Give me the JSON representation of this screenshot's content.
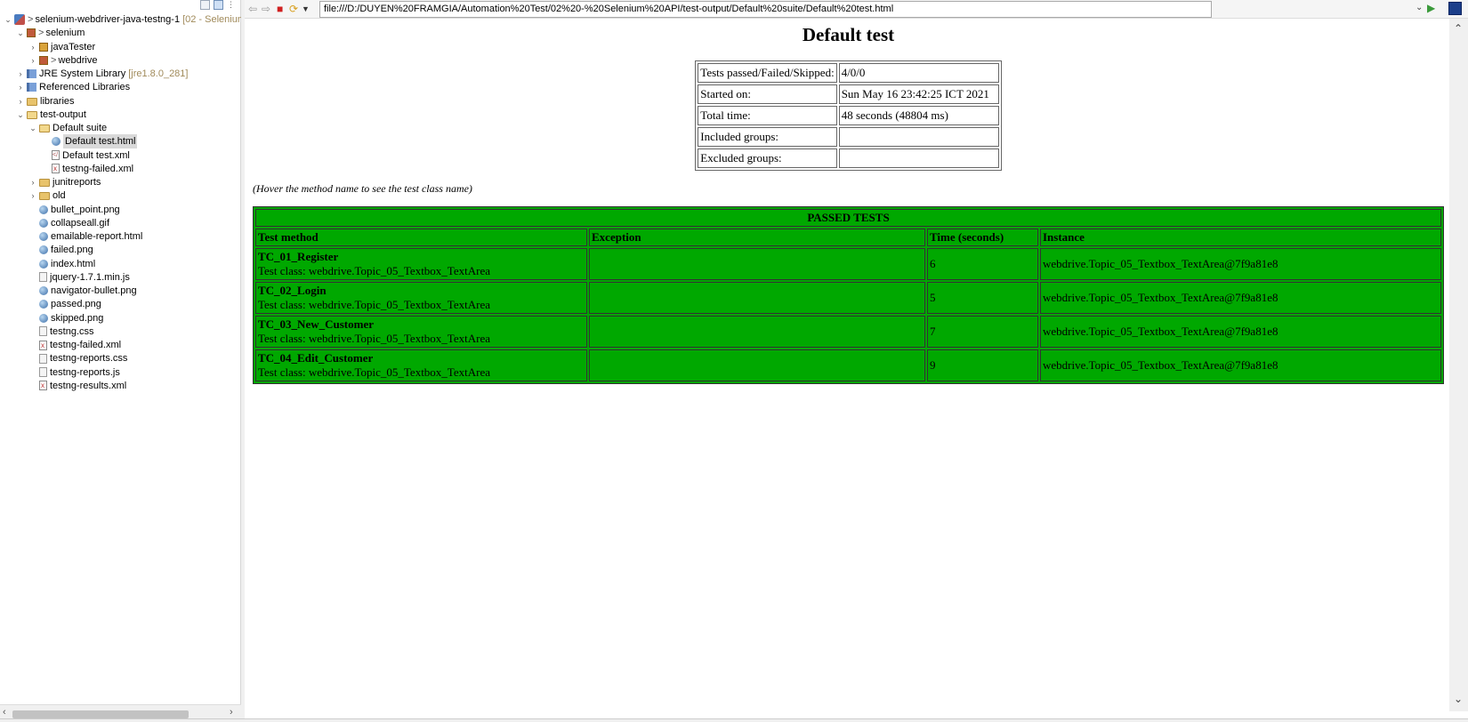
{
  "explorer": {
    "items": [
      {
        "label": "selenium-webdriver-java-testng-1",
        "extra": "[02 - Selenium",
        "prefix": ">",
        "chevron": "v",
        "icon": "project",
        "indent": 0
      },
      {
        "label": "selenium",
        "prefix": ">",
        "chevron": "v",
        "icon": "pkg-red",
        "indent": 1
      },
      {
        "label": "javaTester",
        "chevron": ">",
        "icon": "pkg",
        "indent": 2
      },
      {
        "label": "webdrive",
        "prefix": ">",
        "chevron": ">",
        "icon": "pkg-red",
        "indent": 2
      },
      {
        "label": "JRE System Library",
        "extra": "[jre1.8.0_281]",
        "chevron": ">",
        "icon": "lib",
        "indent": 1
      },
      {
        "label": "Referenced Libraries",
        "chevron": ">",
        "icon": "lib",
        "indent": 1
      },
      {
        "label": "libraries",
        "chevron": ">",
        "icon": "folder",
        "indent": 1
      },
      {
        "label": "test-output",
        "chevron": "v",
        "icon": "folder-open",
        "indent": 1
      },
      {
        "label": "Default suite",
        "chevron": "v",
        "icon": "folder-open",
        "indent": 2
      },
      {
        "label": "Default test.html",
        "icon": "globe",
        "indent": 3,
        "selected": true
      },
      {
        "label": "Default test.xml",
        "icon": "xmlsrc",
        "indent": 3
      },
      {
        "label": "testng-failed.xml",
        "icon": "xml",
        "indent": 3
      },
      {
        "label": "junitreports",
        "chevron": ">",
        "icon": "folder",
        "indent": 2
      },
      {
        "label": "old",
        "chevron": ">",
        "icon": "folder",
        "indent": 2
      },
      {
        "label": "bullet_point.png",
        "icon": "globe",
        "indent": 2
      },
      {
        "label": "collapseall.gif",
        "icon": "globe",
        "indent": 2
      },
      {
        "label": "emailable-report.html",
        "icon": "globe",
        "indent": 2
      },
      {
        "label": "failed.png",
        "icon": "globe",
        "indent": 2
      },
      {
        "label": "index.html",
        "icon": "globe",
        "indent": 2
      },
      {
        "label": "jquery-1.7.1.min.js",
        "icon": "text",
        "indent": 2
      },
      {
        "label": "navigator-bullet.png",
        "icon": "globe",
        "indent": 2
      },
      {
        "label": "passed.png",
        "icon": "globe",
        "indent": 2
      },
      {
        "label": "skipped.png",
        "icon": "globe",
        "indent": 2
      },
      {
        "label": "testng.css",
        "icon": "text",
        "indent": 2
      },
      {
        "label": "testng-failed.xml",
        "icon": "xml",
        "indent": 2
      },
      {
        "label": "testng-reports.css",
        "icon": "text",
        "indent": 2
      },
      {
        "label": "testng-reports.js",
        "icon": "text",
        "indent": 2
      },
      {
        "label": "testng-results.xml",
        "icon": "xml",
        "indent": 2
      }
    ]
  },
  "browser": {
    "url": "file:///D:/DUYEN%20FRAMGIA/Automation%20Test/02%20-%20Selenium%20API/test-output/Default%20suite/Default%20test.html"
  },
  "report": {
    "title": "Default test",
    "summary": [
      {
        "label": "Tests passed/Failed/Skipped:",
        "value": "4/0/0"
      },
      {
        "label": "Started on:",
        "value": "Sun May 16 23:42:25 ICT 2021"
      },
      {
        "label": "Total time:",
        "value": "48 seconds (48804 ms)"
      },
      {
        "label": "Included groups:",
        "value": ""
      },
      {
        "label": "Excluded groups:",
        "value": ""
      }
    ],
    "hover_note": "(Hover the method name to see the test class name)",
    "passed_title": "PASSED TESTS",
    "columns": [
      "Test method",
      "Exception",
      "Time (seconds)",
      "Instance"
    ],
    "rows": [
      {
        "method": "TC_01_Register",
        "class": "Test class: webdrive.Topic_05_Textbox_TextArea",
        "exception": "",
        "time": "6",
        "instance": "webdrive.Topic_05_Textbox_TextArea@7f9a81e8"
      },
      {
        "method": "TC_02_Login",
        "class": "Test class: webdrive.Topic_05_Textbox_TextArea",
        "exception": "",
        "time": "5",
        "instance": "webdrive.Topic_05_Textbox_TextArea@7f9a81e8"
      },
      {
        "method": "TC_03_New_Customer",
        "class": "Test class: webdrive.Topic_05_Textbox_TextArea",
        "exception": "",
        "time": "7",
        "instance": "webdrive.Topic_05_Textbox_TextArea@7f9a81e8"
      },
      {
        "method": "TC_04_Edit_Customer",
        "class": "Test class: webdrive.Topic_05_Textbox_TextArea",
        "exception": "",
        "time": "9",
        "instance": "webdrive.Topic_05_Textbox_TextArea@7f9a81e8"
      }
    ],
    "pass_color": "#00a800"
  }
}
